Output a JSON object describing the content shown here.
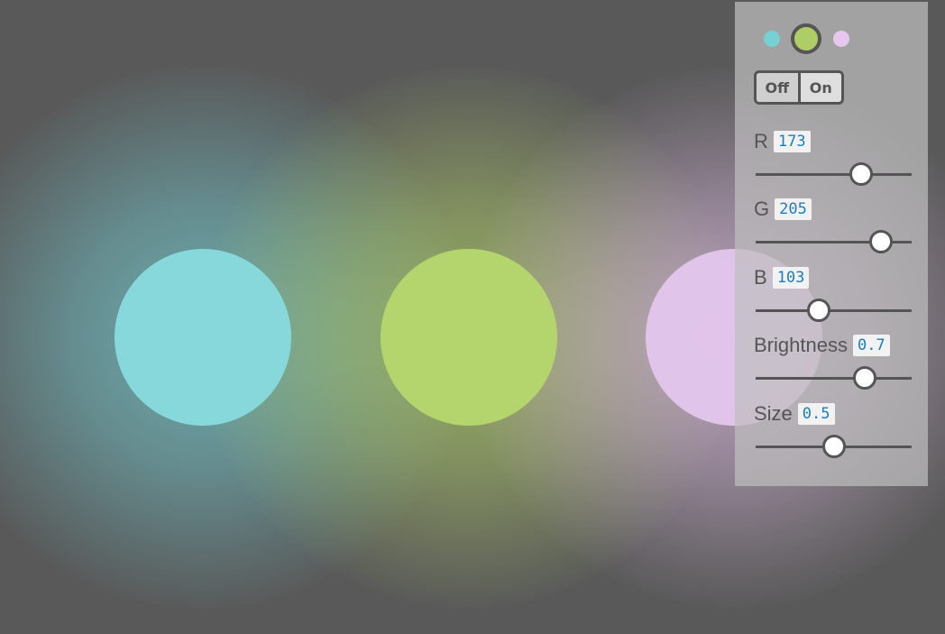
{
  "lights": [
    {
      "name": "cyan",
      "color": "#86d8da"
    },
    {
      "name": "green",
      "color": "#b4d46e"
    },
    {
      "name": "pink",
      "color": "#e4c6ec"
    }
  ],
  "panel": {
    "swatch_colors": [
      "#77d0d4",
      "#afcd67",
      "#e6c8ee"
    ],
    "selected_swatch": 1,
    "toggle": {
      "off_label": "Off",
      "on_label": "On",
      "state": "on"
    },
    "controls": [
      {
        "label": "R",
        "value": "173",
        "fraction": 0.678
      },
      {
        "label": "G",
        "value": "205",
        "fraction": 0.804
      },
      {
        "label": "B",
        "value": "103",
        "fraction": 0.404
      },
      {
        "label": "Brightness",
        "value": "0.7",
        "fraction": 0.7
      },
      {
        "label": "Size",
        "value": "0.5",
        "fraction": 0.5
      }
    ]
  }
}
